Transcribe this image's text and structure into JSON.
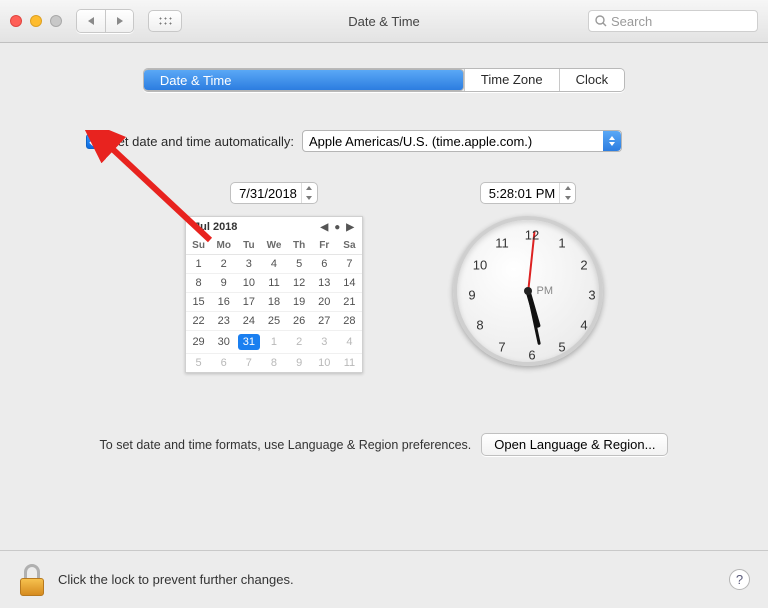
{
  "titlebar": {
    "title": "Date & Time",
    "search_placeholder": "Search"
  },
  "tabs": {
    "date_time": "Date & Time",
    "time_zone": "Time Zone",
    "clock": "Clock"
  },
  "auto": {
    "label": "Set date and time automatically:",
    "server": "Apple Americas/U.S. (time.apple.com.)"
  },
  "date_input": "7/31/2018",
  "time_input": "5:28:01 PM",
  "calendar": {
    "month_label": "Jul 2018",
    "dow": [
      "Su",
      "Mo",
      "Tu",
      "We",
      "Th",
      "Fr",
      "Sa"
    ],
    "weeks": [
      [
        {
          "d": "1"
        },
        {
          "d": "2"
        },
        {
          "d": "3"
        },
        {
          "d": "4"
        },
        {
          "d": "5"
        },
        {
          "d": "6"
        },
        {
          "d": "7"
        }
      ],
      [
        {
          "d": "8"
        },
        {
          "d": "9"
        },
        {
          "d": "10"
        },
        {
          "d": "11"
        },
        {
          "d": "12"
        },
        {
          "d": "13"
        },
        {
          "d": "14"
        }
      ],
      [
        {
          "d": "15"
        },
        {
          "d": "16"
        },
        {
          "d": "17"
        },
        {
          "d": "18"
        },
        {
          "d": "19"
        },
        {
          "d": "20"
        },
        {
          "d": "21"
        }
      ],
      [
        {
          "d": "22"
        },
        {
          "d": "23"
        },
        {
          "d": "24"
        },
        {
          "d": "25"
        },
        {
          "d": "26"
        },
        {
          "d": "27"
        },
        {
          "d": "28"
        }
      ],
      [
        {
          "d": "29"
        },
        {
          "d": "30"
        },
        {
          "d": "31",
          "today": true
        },
        {
          "d": "1",
          "out": true
        },
        {
          "d": "2",
          "out": true
        },
        {
          "d": "3",
          "out": true
        },
        {
          "d": "4",
          "out": true
        }
      ],
      [
        {
          "d": "5",
          "out": true
        },
        {
          "d": "6",
          "out": true
        },
        {
          "d": "7",
          "out": true
        },
        {
          "d": "8",
          "out": true
        },
        {
          "d": "9",
          "out": true
        },
        {
          "d": "10",
          "out": true
        },
        {
          "d": "11",
          "out": true
        }
      ]
    ]
  },
  "analog": {
    "ampm": "PM",
    "hour_angle": 164,
    "minute_angle": 168,
    "second_angle": 6,
    "numbers": [
      "12",
      "1",
      "2",
      "3",
      "4",
      "5",
      "6",
      "7",
      "8",
      "9",
      "10",
      "11"
    ]
  },
  "formats": {
    "hint": "To set date and time formats, use Language & Region preferences.",
    "button": "Open Language & Region..."
  },
  "footer": {
    "text": "Click the lock to prevent further changes.",
    "help": "?"
  }
}
